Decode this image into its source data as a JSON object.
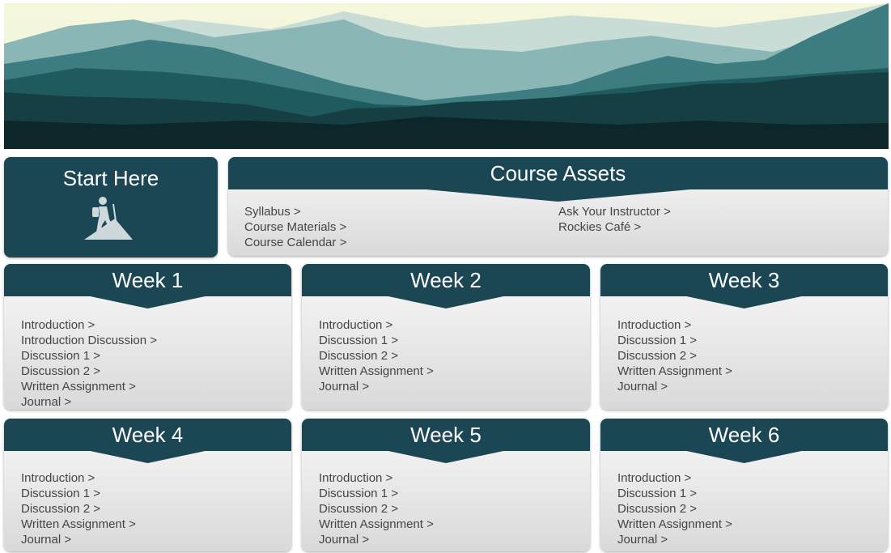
{
  "banner": {
    "icon": "mountain-landscape-image"
  },
  "start_here": {
    "title": "Start Here",
    "icon": "hiker-icon"
  },
  "course_assets": {
    "title": "Course Assets",
    "left_links": [
      "Syllabus",
      "Course Materials",
      "Course Calendar"
    ],
    "right_links": [
      "Ask Your Instructor",
      "Rockies Café"
    ]
  },
  "weeks": [
    {
      "title": "Week 1",
      "links": [
        "Introduction",
        "Introduction Discussion",
        "Discussion 1",
        "Discussion 2",
        "Written Assignment",
        "Journal"
      ]
    },
    {
      "title": "Week 2",
      "links": [
        "Introduction",
        "Discussion 1",
        "Discussion 2",
        "Written Assignment",
        "Journal"
      ]
    },
    {
      "title": "Week 3",
      "links": [
        "Introduction",
        "Discussion 1",
        "Discussion 2",
        "Written Assignment",
        "Journal"
      ]
    },
    {
      "title": "Week 4",
      "links": [
        "Introduction",
        "Discussion 1",
        "Discussion 2",
        "Written Assignment",
        "Journal"
      ]
    },
    {
      "title": "Week 5",
      "links": [
        "Introduction",
        "Discussion 1",
        "Discussion 2",
        "Written Assignment",
        "Journal"
      ]
    },
    {
      "title": "Week 6",
      "links": [
        "Introduction",
        "Discussion 1",
        "Discussion 2",
        "Written Assignment",
        "Journal"
      ]
    }
  ],
  "colors": {
    "header": "#1b4654",
    "link_text": "#444444"
  }
}
